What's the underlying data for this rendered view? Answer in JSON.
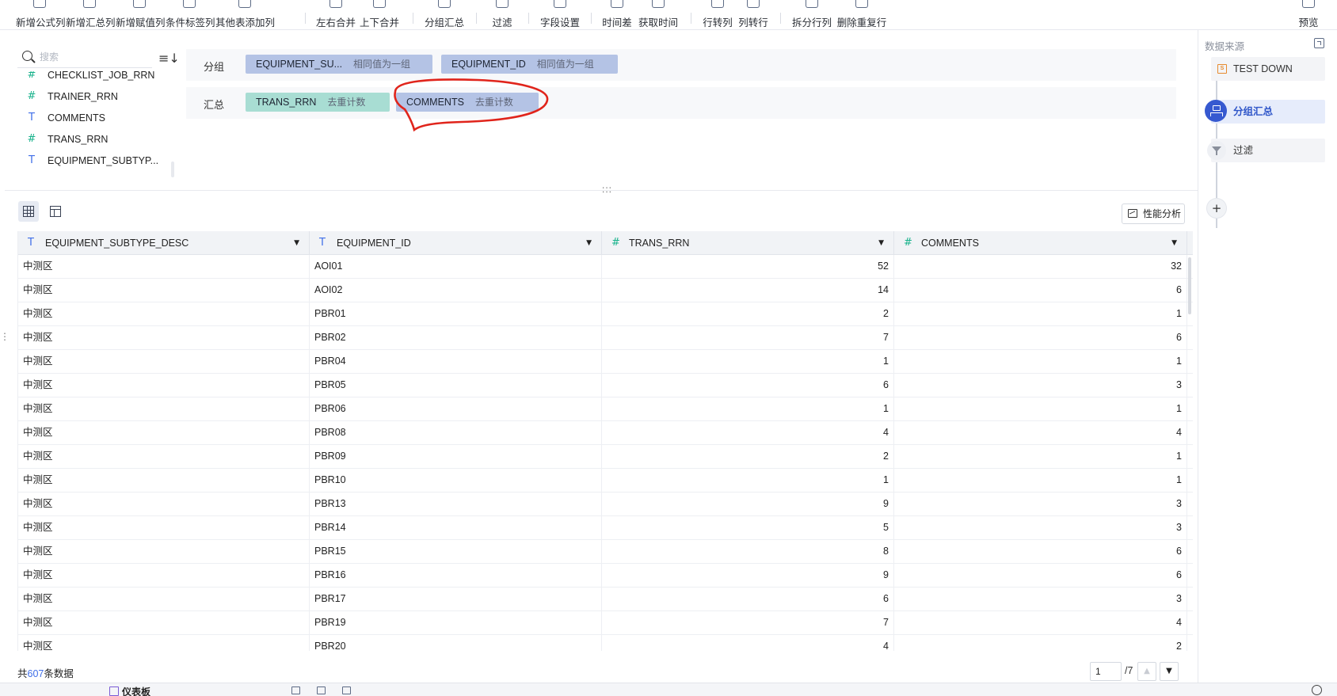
{
  "toolbar": {
    "items": [
      {
        "label": "新增公式列",
        "icon": "formula-icon"
      },
      {
        "label": "新增汇总列",
        "icon": "sigma-icon"
      },
      {
        "label": "新增赋值列",
        "icon": "assign-icon"
      },
      {
        "label": "条件标签列",
        "icon": "tag-icon"
      },
      {
        "label": "其他表添加列",
        "icon": "table-add-icon"
      },
      {
        "label": "左右合并",
        "icon": "merge-lr-icon"
      },
      {
        "label": "上下合并",
        "icon": "merge-tb-icon"
      },
      {
        "label": "分组汇总",
        "icon": "group-icon"
      },
      {
        "label": "过滤",
        "icon": "filter-icon"
      },
      {
        "label": "字段设置",
        "icon": "field-settings-icon"
      },
      {
        "label": "时间差",
        "icon": "time-diff-icon"
      },
      {
        "label": "获取时间",
        "icon": "get-time-icon"
      },
      {
        "label": "行转列",
        "icon": "row-to-col-icon"
      },
      {
        "label": "列转行",
        "icon": "col-to-row-icon"
      },
      {
        "label": "拆分行列",
        "icon": "split-icon"
      },
      {
        "label": "删除重复行",
        "icon": "dedupe-icon"
      }
    ],
    "preview_label": "预览"
  },
  "field_panel": {
    "search_placeholder": "搜索",
    "fields": [
      {
        "type": "#",
        "name": "CHECKLIST_JOB_RRN"
      },
      {
        "type": "#",
        "name": "TRAINER_RRN"
      },
      {
        "type": "T",
        "name": "COMMENTS"
      },
      {
        "type": "#",
        "name": "TRANS_RRN"
      },
      {
        "type": "T",
        "name": "EQUIPMENT_SUBTYP..."
      }
    ]
  },
  "config": {
    "group_label": "分组",
    "group_pills": [
      {
        "name": "EQUIPMENT_SU...",
        "rule": "相同值为一组"
      },
      {
        "name": "EQUIPMENT_ID",
        "rule": "相同值为一组"
      }
    ],
    "summary_label": "汇总",
    "summary_pills": [
      {
        "name": "TRANS_RRN",
        "rule": "去重计数"
      },
      {
        "name": "COMMENTS",
        "rule": "去重计数"
      }
    ]
  },
  "view": {
    "perf_label": "性能分析"
  },
  "table": {
    "columns": [
      {
        "type": "T",
        "name": "EQUIPMENT_SUBTYPE_DESC"
      },
      {
        "type": "T",
        "name": "EQUIPMENT_ID"
      },
      {
        "type": "#",
        "name": "TRANS_RRN"
      },
      {
        "type": "#",
        "name": "COMMENTS"
      }
    ],
    "rows": [
      [
        "中测区",
        "AOI01",
        "52",
        "32"
      ],
      [
        "中测区",
        "AOI02",
        "14",
        "6"
      ],
      [
        "中测区",
        "PBR01",
        "2",
        "1"
      ],
      [
        "中测区",
        "PBR02",
        "7",
        "6"
      ],
      [
        "中测区",
        "PBR04",
        "1",
        "1"
      ],
      [
        "中测区",
        "PBR05",
        "6",
        "3"
      ],
      [
        "中测区",
        "PBR06",
        "1",
        "1"
      ],
      [
        "中测区",
        "PBR08",
        "4",
        "4"
      ],
      [
        "中测区",
        "PBR09",
        "2",
        "1"
      ],
      [
        "中测区",
        "PBR10",
        "1",
        "1"
      ],
      [
        "中测区",
        "PBR13",
        "9",
        "3"
      ],
      [
        "中测区",
        "PBR14",
        "5",
        "3"
      ],
      [
        "中测区",
        "PBR15",
        "8",
        "6"
      ],
      [
        "中测区",
        "PBR16",
        "9",
        "6"
      ],
      [
        "中测区",
        "PBR17",
        "6",
        "3"
      ],
      [
        "中测区",
        "PBR19",
        "7",
        "4"
      ],
      [
        "中测区",
        "PBR20",
        "4",
        "2"
      ]
    ]
  },
  "footer": {
    "total_prefix": "共",
    "total_count": "607",
    "total_suffix": "条数据",
    "page_value": "1",
    "page_total": "/7"
  },
  "bottom_bar": {
    "dashboard_tab": "仪表板"
  },
  "flow": {
    "title": "数据来源",
    "nodes": [
      {
        "label": "TEST DOWN",
        "icon": "source-icon",
        "active": false
      },
      {
        "label": "分组汇总",
        "icon": "group-icon",
        "active": true
      },
      {
        "label": "过滤",
        "icon": "filter-icon",
        "active": false
      }
    ]
  },
  "colors": {
    "accent": "#3659d0",
    "group_pill": "#b4c3e5",
    "summary_pill_numeric": "#a8ddd3",
    "annotation": "#e0241b"
  }
}
